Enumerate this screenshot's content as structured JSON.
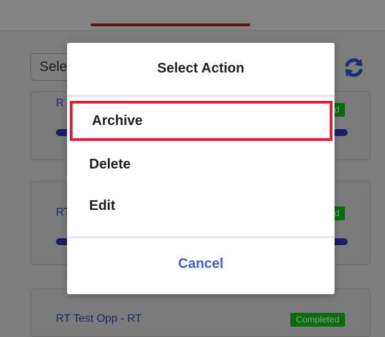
{
  "background": {
    "select_text": "Sele",
    "cards": [
      {
        "title": "R",
        "badge": "d"
      },
      {
        "title": "RT",
        "badge": "d"
      },
      {
        "title": "RT Test Opp - RT",
        "badge": "Completed"
      }
    ]
  },
  "dialog": {
    "title": "Select Action",
    "actions": [
      "Archive",
      "Delete",
      "Edit"
    ],
    "cancel_label": "Cancel"
  },
  "colors": {
    "highlight_border": "#e01e37",
    "cancel_text": "#3f5ed1",
    "tab_underline": "#6a0f11"
  },
  "icons": [
    "refresh-icon"
  ]
}
